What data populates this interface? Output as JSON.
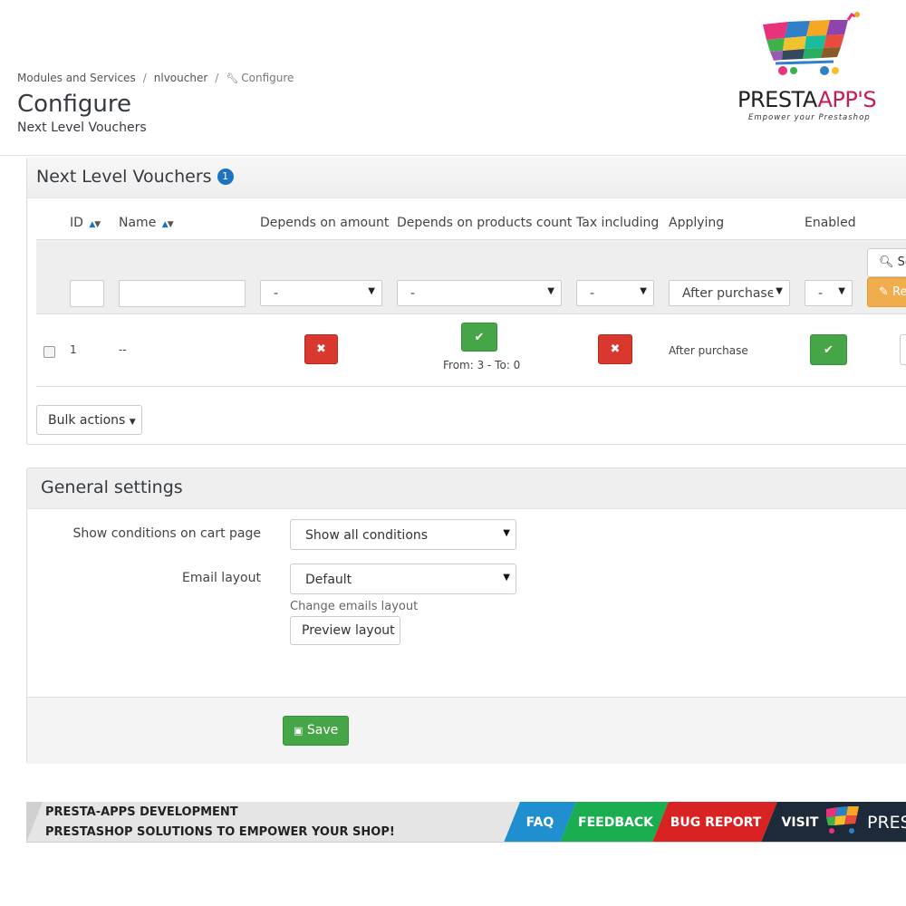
{
  "breadcrumb": {
    "items": [
      "Modules and Services",
      "nlvoucher"
    ],
    "current": "Configure"
  },
  "page": {
    "title": "Configure",
    "subtitle": "Next Level Vouchers"
  },
  "logo": {
    "name_main": "PRESTA",
    "name_accent": "APP'S",
    "tagline": "Empower your Prestashop"
  },
  "vouchers_panel": {
    "title": "Next Level Vouchers",
    "count": "1",
    "columns": {
      "id": "ID",
      "name": "Name",
      "depends_amount": "Depends on amount",
      "depends_products": "Depends on products count",
      "tax_including": "Tax including",
      "applying": "Applying",
      "enabled": "Enabled"
    },
    "filters": {
      "depends_amount": "-",
      "depends_products": "-",
      "tax_including": "-",
      "applying": "After purchase",
      "enabled": "-",
      "search_label": "Search",
      "reset_label": "Reset"
    },
    "rows": [
      {
        "id": "1",
        "name": "--",
        "depends_products_detail": "From: 3 - To: 0",
        "applying": "After purchase"
      }
    ],
    "bulk_actions_label": "Bulk actions"
  },
  "general_settings": {
    "title": "General settings",
    "show_conditions_label": "Show conditions on cart page",
    "show_conditions_value": "Show all conditions",
    "email_layout_label": "Email layout",
    "email_layout_value": "Default",
    "email_help": "Change emails layout",
    "preview_label": "Preview layout",
    "save_label": "Save"
  },
  "footer_banner": {
    "line1": "PRESTA-APPS DEVELOPMENT",
    "line2": "PRESTASHOP SOLUTIONS TO EMPOWER YOUR SHOP!",
    "faq": "FAQ",
    "feedback": "FEEDBACK",
    "bug_report": "BUG REPORT",
    "visit": "VISIT",
    "brand_fragment": "PRES"
  },
  "colors": {
    "accent_blue": "#1e73be",
    "success_green": "#46a546",
    "danger_red": "#d9382f",
    "warning_orange": "#f0ad4e",
    "faq_blue": "#1f8fd0",
    "feedback_green": "#1aae50",
    "bug_red": "#d92222",
    "visit_navy": "#1d2a3a"
  }
}
